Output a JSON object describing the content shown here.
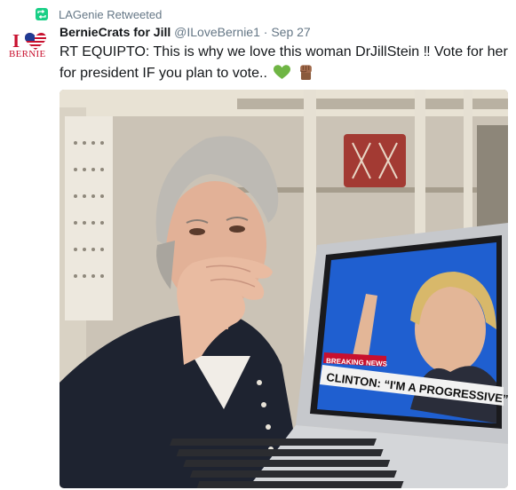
{
  "retweet": {
    "label": "LAGenie Retweeted",
    "icon": "retweet-icon"
  },
  "author": {
    "name": "BernieCrats for Jill",
    "handle": "@ILoveBernie1",
    "separator": "·",
    "time": "Sep 27"
  },
  "avatar": {
    "line1": "I",
    "line2": "BERNIE",
    "icon": "heart-flag-icon"
  },
  "tweet": {
    "text": "RT EQUIPTO: This is why we love this woman DrJillStein ‼ Vote for her for president IF you plan to vote..",
    "emojis": [
      "green-heart-icon",
      "raised-fist-icon"
    ]
  },
  "photo": {
    "banner": "BREAKING NEWS",
    "caption": "CLINTON: “I'M A PROGRESSIVE”"
  },
  "colors": {
    "accent_green": "#19cf86",
    "muted": "#657786",
    "brand_red": "#c8102e"
  }
}
